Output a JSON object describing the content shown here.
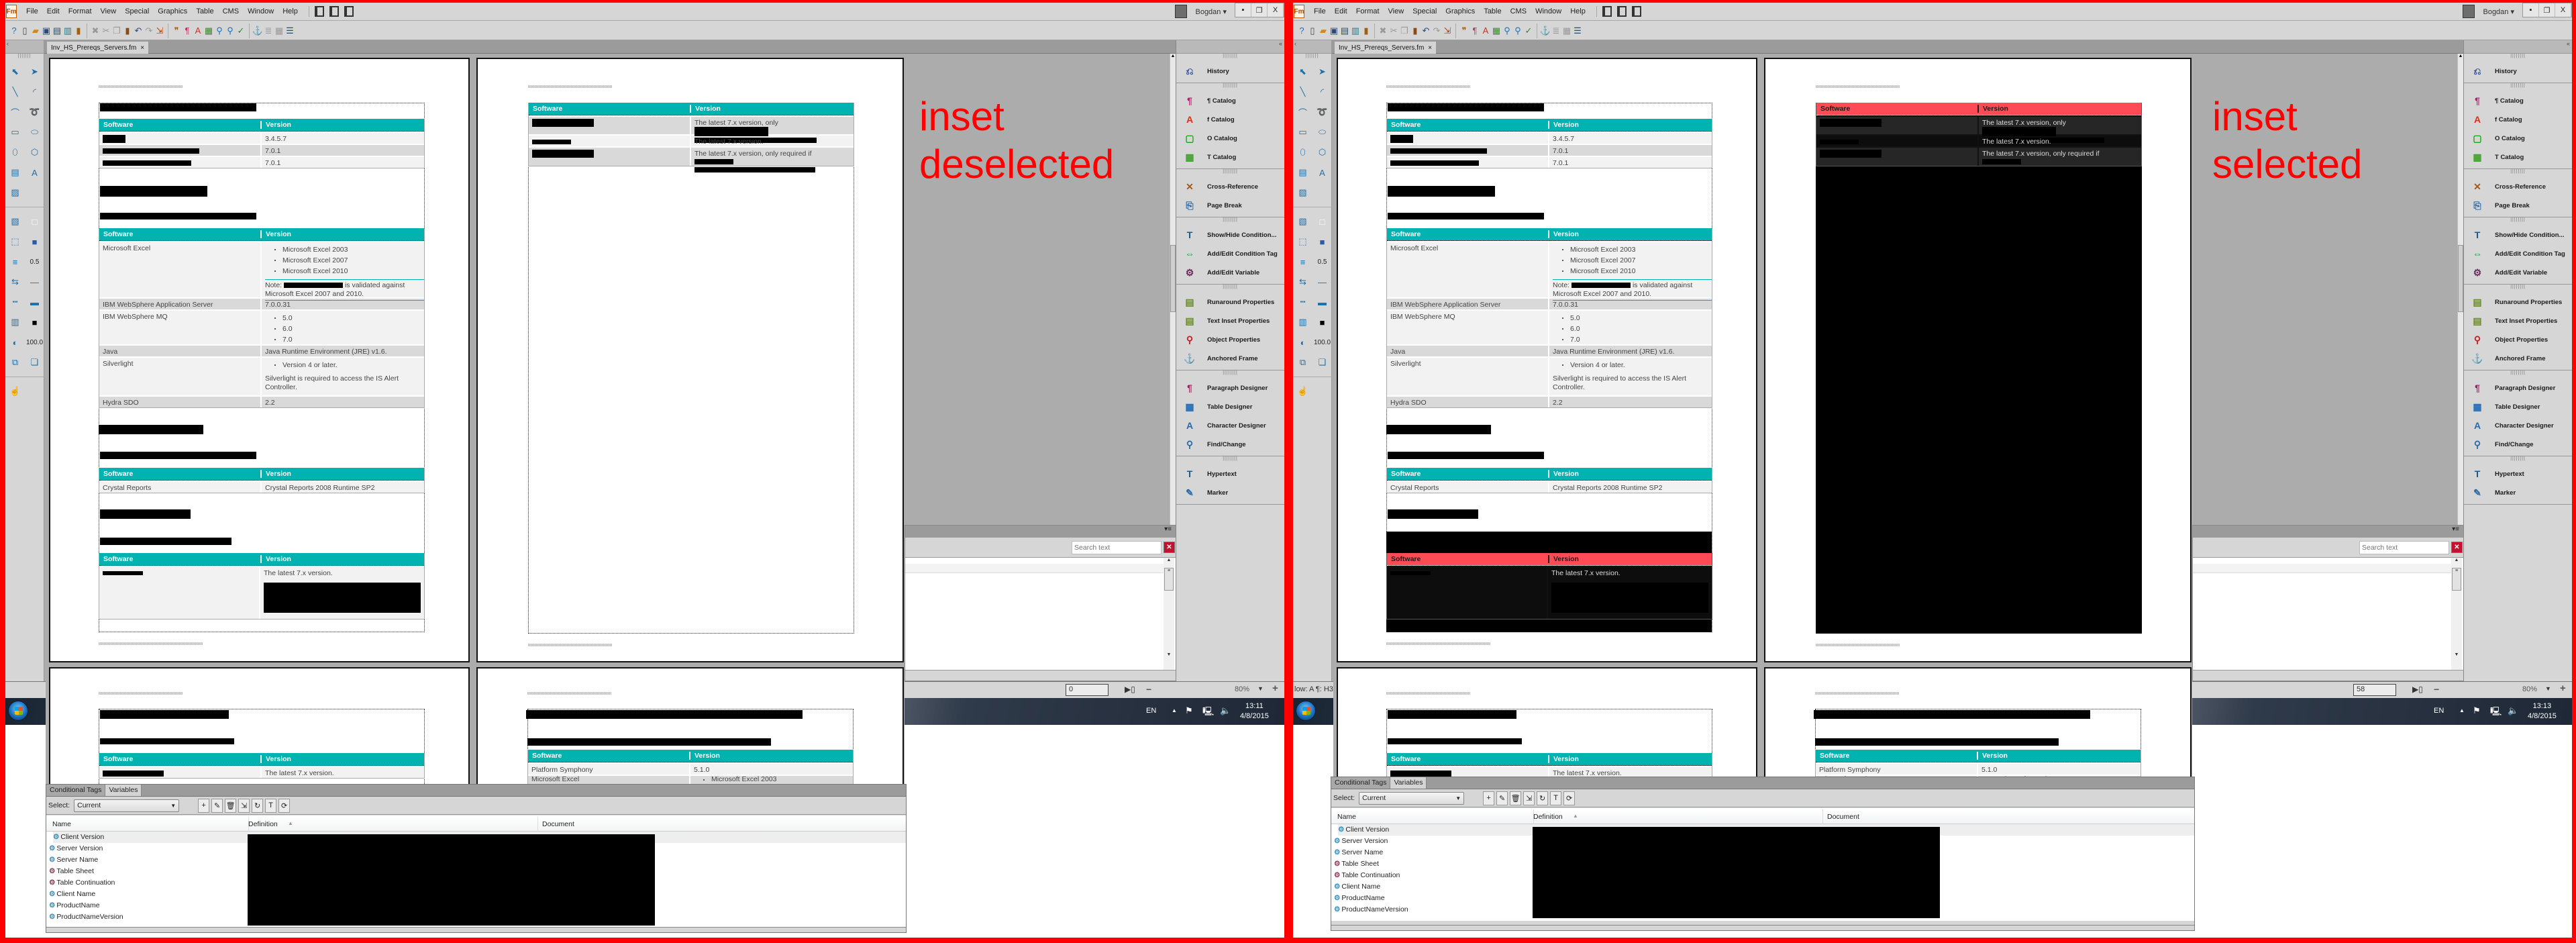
{
  "app": {
    "logo": "Fm",
    "menu": [
      "File",
      "Edit",
      "Format",
      "View",
      "Special",
      "Graphics",
      "Table",
      "CMS",
      "Window",
      "Help"
    ],
    "user": "Bogdan",
    "window_controls": [
      "minimize",
      "restore",
      "close"
    ],
    "close_glyph": "X",
    "toolbar_icons": [
      "help",
      "new",
      "open",
      "save",
      "save-as",
      "print",
      "lock",
      "sep",
      "delete",
      "cut",
      "copy",
      "paste",
      "undo",
      "redo",
      "import",
      "sep",
      "smart-quotes",
      "paragraph-catalog",
      "character-catalog",
      "table-catalog",
      "find",
      "find-next",
      "spell-check",
      "sep",
      "anchor",
      "paragraph-designer",
      "table-insert",
      "align"
    ],
    "doc_tab": "Inv_HS_Prereqs_Servers.fm",
    "doc_tab_close": "×",
    "palette": {
      "icons": [
        "smart-select",
        "object-select",
        "line",
        "arc",
        "polyline",
        "freehand",
        "rectangle",
        "rounded-rectangle",
        "oval",
        "polygon",
        "text-column",
        "text-line",
        "graphic-frame",
        "sep",
        "fill-pattern",
        "fill-white",
        "pen-pattern",
        "pen-fill",
        "line-width",
        "line-width-value",
        "arrow-style",
        "line-end",
        "dash-style",
        "line-cap",
        "color-tints",
        "color-black",
        "overprint",
        "tint-value",
        "runaround",
        "object-properties",
        "sep",
        "hotspot"
      ],
      "line_width": "0.5",
      "tint": "100.0"
    },
    "pods": [
      [
        {
          "icon": "history-icon",
          "label": "History"
        }
      ],
      [
        {
          "icon": "paragraph-catalog-icon",
          "label": "¶ Catalog"
        },
        {
          "icon": "character-catalog-icon",
          "label": "f Catalog"
        },
        {
          "icon": "object-catalog-icon",
          "label": "O Catalog"
        },
        {
          "icon": "table-catalog-icon",
          "label": "T Catalog"
        }
      ],
      [
        {
          "icon": "cross-reference-icon",
          "label": "Cross-Reference"
        },
        {
          "icon": "page-break-icon",
          "label": "Page Break"
        }
      ],
      [
        {
          "icon": "show-hide-conditions-icon",
          "label": "Show/Hide Condition..."
        },
        {
          "icon": "condition-tag-icon",
          "label": "Add/Edit Condition Tag"
        },
        {
          "icon": "variable-icon",
          "label": "Add/Edit Variable"
        }
      ],
      [
        {
          "icon": "runaround-icon",
          "label": "Runaround Properties"
        },
        {
          "icon": "text-inset-icon",
          "label": "Text Inset Properties"
        },
        {
          "icon": "object-properties-icon",
          "label": "Object Properties"
        },
        {
          "icon": "anchored-frame-icon",
          "label": "Anchored Frame"
        }
      ],
      [
        {
          "icon": "paragraph-designer-icon",
          "label": "Paragraph Designer"
        },
        {
          "icon": "table-designer-icon",
          "label": "Table Designer"
        },
        {
          "icon": "character-designer-icon",
          "label": "Character Designer"
        },
        {
          "icon": "find-change-icon",
          "label": "Find/Change"
        }
      ],
      [
        {
          "icon": "hypertext-icon",
          "label": "Hypertext"
        },
        {
          "icon": "marker-icon",
          "label": "Marker"
        }
      ]
    ],
    "search_placeholder": "Search text",
    "zoom": "80%",
    "zoom_minus": "−",
    "zoom_plus": "+",
    "zoom_dropdown": "▼",
    "language": "EN",
    "date": "4/8/2015",
    "variables_panel": {
      "tabs": [
        "Conditional Tags",
        "Variables"
      ],
      "active_tab": "Variables",
      "select_label": "Select:",
      "select_value": "Current",
      "toolbar_icons": [
        "add-variable",
        "edit-variable",
        "delete-variable",
        "insert-variable",
        "update-variable",
        "convert-to-text",
        "refresh"
      ],
      "columns": [
        "Name",
        "Definition",
        "Document"
      ],
      "sorted_column": "Definition",
      "sort_direction": "ascending",
      "rows": [
        {
          "name": "Client Version",
          "kind": "user"
        },
        {
          "name": "Server Version",
          "kind": "user"
        },
        {
          "name": "Server Name",
          "kind": "user"
        },
        {
          "name": "Table Sheet",
          "kind": "system"
        },
        {
          "name": "Table Continuation",
          "kind": "system"
        },
        {
          "name": "Client Name",
          "kind": "user"
        },
        {
          "name": "ProductName",
          "kind": "user"
        },
        {
          "name": "ProductNameVersion",
          "kind": "user"
        }
      ],
      "kind_colors": {
        "user": "#3a8fb7",
        "system": "#8a3a5a"
      }
    }
  },
  "doc": {
    "col_software": "Software",
    "col_version": "Version",
    "header_color": "#00b3b0",
    "selected_header_color": "#ff4b55",
    "p1": {
      "t1_versions": [
        "3.4.5.7",
        "7.0.1",
        "7.0.1"
      ],
      "excel": {
        "name": "Microsoft Excel",
        "versions": [
          "Microsoft Excel 2003",
          "Microsoft Excel 2007",
          "Microsoft Excel 2010"
        ],
        "note_label": "Note:",
        "note_text": "is validated against Microsoft Excel 2007 and 2010."
      },
      "was": {
        "name": "IBM WebSphere Application Server",
        "version": "7.0.0.31"
      },
      "mq": {
        "name": "IBM WebSphere MQ",
        "versions": [
          "5.0",
          "6.0",
          "7.0"
        ]
      },
      "java": {
        "name": "Java",
        "version": "Java Runtime Environment (JRE) v1.6."
      },
      "silverlight": {
        "name": "Silverlight",
        "bullet": "Version 4 or later.",
        "note": "Silverlight is required to access the IS Alert Controller."
      },
      "hydra": {
        "name": "Hydra SDO",
        "version": "2.2"
      },
      "crystal": {
        "name": "Crystal Reports",
        "version": "Crystal Reports 2008 Runtime SP2"
      },
      "t4_version": "The latest 7.x version."
    },
    "p2": {
      "versions": [
        "The latest 7.x version, only",
        "The latest 7.x version.",
        "The latest 7.x version, only required if"
      ]
    },
    "p3": {
      "version": "The latest 7.x version."
    },
    "p4": {
      "rows": [
        [
          "Platform Symphony",
          "5.1.0"
        ],
        [
          "Microsoft Excel",
          "Microsoft Excel 2003"
        ]
      ]
    }
  },
  "panes": [
    {
      "annotation": [
        "inset",
        "deselected"
      ],
      "annotation_color": "#ff0000",
      "inset_selected": false,
      "page_field": "0",
      "status_left": "",
      "time": "13:11"
    },
    {
      "annotation": [
        "inset",
        "selected"
      ],
      "annotation_color": "#ff0000",
      "inset_selected": true,
      "page_field": "58",
      "status_left": "low: A  ¶: H3",
      "time": "13:13"
    }
  ]
}
